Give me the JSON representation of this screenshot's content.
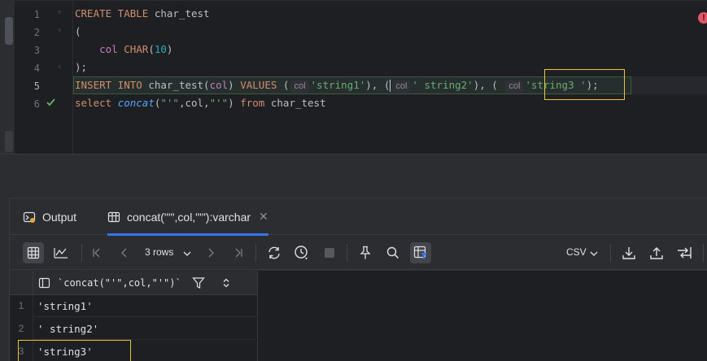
{
  "editor": {
    "line_numbers": [
      "1",
      "2",
      "3",
      "4",
      "5",
      "6"
    ],
    "lines": {
      "l1": {
        "kw1": "CREATE TABLE",
        "rest": " char_test"
      },
      "l2": {
        "text": "("
      },
      "l3": {
        "indent": "    ",
        "col": "col",
        "sp": " ",
        "kw": "CHAR",
        "open": "(",
        "num": "10",
        "close": ")"
      },
      "l4": {
        "text": ");"
      },
      "l5": {
        "kw1": "INSERT INTO",
        "tbl": " char_test(",
        "col": "col",
        "p1": ") ",
        "kw2": "VALUES",
        "p2": " (",
        "hint": "col",
        "s1": "'string1'",
        "p3": "), ",
        "p4": "(",
        "s2": "' string2'",
        "p5": "), ( ",
        "s3": "'string3 '",
        "p6": ");"
      },
      "l6": {
        "kw1": "select",
        "sp": " ",
        "fn": "concat",
        "open": "(",
        "q1": "\"'\"",
        "mid": ",col,",
        "q2": "\"'\"",
        "close": ") ",
        "kw2": "from",
        "rest": " char_test"
      }
    }
  },
  "panel": {
    "tabs": [
      {
        "label": "Output"
      },
      {
        "label": "concat(\"'\",col,\"'\"):varchar"
      }
    ],
    "toolbar": {
      "rows_label": "3 rows",
      "export_format": "CSV"
    },
    "grid": {
      "column_header": "`concat(\"'\",col,\"'\")`",
      "rows": [
        {
          "num": "1",
          "value": "'string1'"
        },
        {
          "num": "2",
          "value": "' string2'"
        },
        {
          "num": "3",
          "value": "'string3'"
        }
      ]
    }
  },
  "colors": {
    "background": "#1e1f22",
    "panel": "#2b2d30",
    "keyword": "#cf8e6d",
    "string": "#6aab73",
    "number": "#2aacb8",
    "function": "#56a8f5",
    "identifier": "#c77dbb",
    "highlight_box": "#e8c53a",
    "accent": "#3574f0"
  },
  "icons": [
    "error-icon",
    "checkmark-icon",
    "output-icon",
    "table-icon",
    "close-icon",
    "grid-view-icon",
    "chart-icon",
    "first-page-icon",
    "previous-page-icon",
    "next-page-icon",
    "last-page-icon",
    "refresh-icon",
    "history-icon",
    "stop-icon",
    "pin-icon",
    "search-icon",
    "filter-icon",
    "download-icon",
    "upload-icon",
    "compare-icon",
    "sort-icon"
  ]
}
